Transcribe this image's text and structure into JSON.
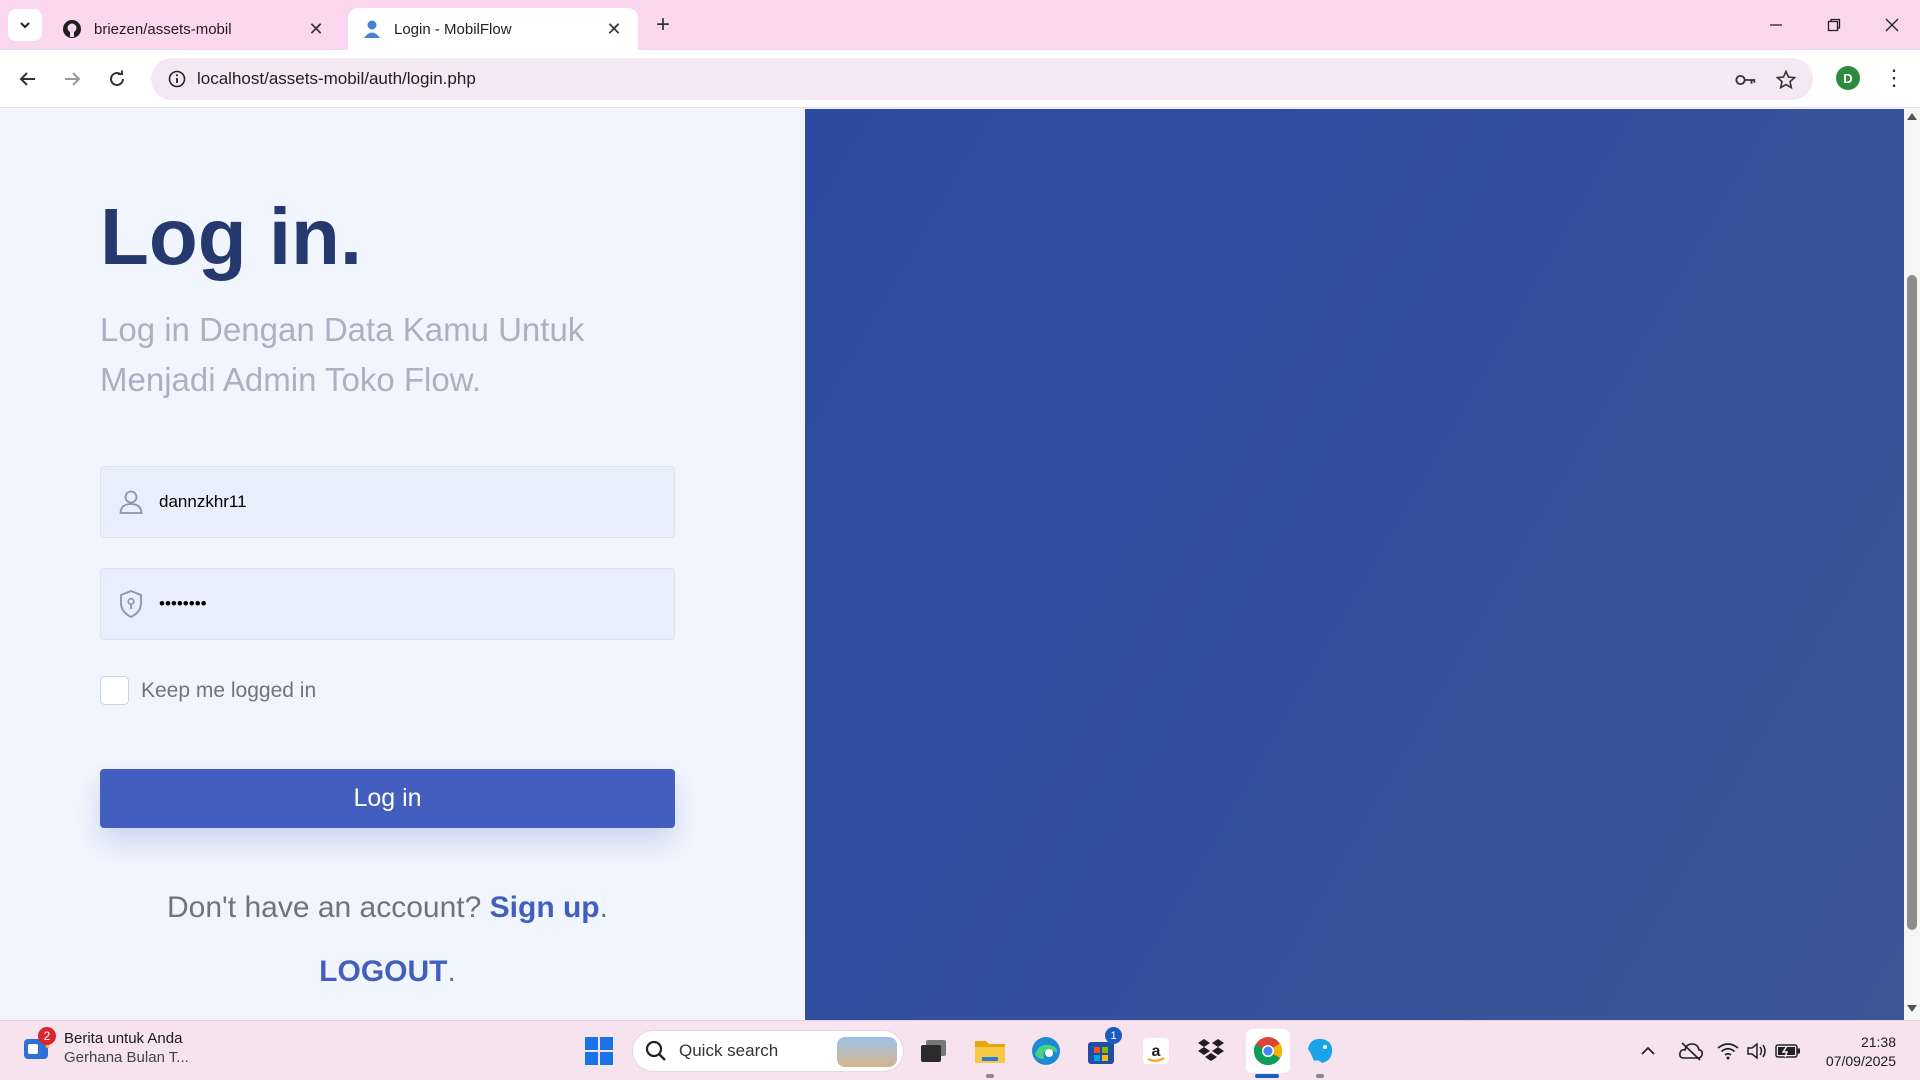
{
  "browser": {
    "tabs": [
      {
        "title": "briezen/assets-mobil",
        "active": false,
        "favicon": "github-icon"
      },
      {
        "title": "Login - MobilFlow",
        "active": true,
        "favicon": "person-icon"
      }
    ],
    "url": "localhost/assets-mobil/auth/login.php",
    "profile_initial": "D"
  },
  "login": {
    "title": "Log in.",
    "subtitle": "Log in Dengan Data Kamu Untuk Menjadi Admin Toko Flow.",
    "username_value": "dannzkhr11",
    "password_value": "••••••••",
    "remember_label": "Keep me logged in",
    "remember_checked": false,
    "button_label": "Log in",
    "signup_prompt": "Don't have an account?",
    "signup_link": "Sign up",
    "logout_link": "LOGOUT",
    "period": "."
  },
  "colors": {
    "primary": "#435ebe",
    "title": "#25396f",
    "right_panel": "#3550a0",
    "tab_bar": "#fad7ee"
  },
  "taskbar": {
    "news_title": "Berita untuk Anda",
    "news_subtitle": "Gerhana Bulan T...",
    "news_badge": "2",
    "search_placeholder": "Quick search",
    "store_badge": "1",
    "time": "21:38",
    "date": "07/09/2025"
  }
}
